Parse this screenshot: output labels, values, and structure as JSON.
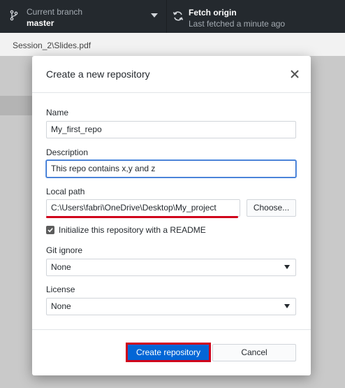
{
  "toolbar": {
    "branch": {
      "title": "Current branch",
      "value": "master",
      "icon": "git-branch-icon"
    },
    "fetch": {
      "title": "Fetch origin",
      "subtitle": "Last fetched a minute ago",
      "icon": "sync-icon"
    }
  },
  "path_bar": {
    "text": "Session_2\\Slides.pdf"
  },
  "background": {
    "hint_char": "."
  },
  "dialog": {
    "title": "Create a new repository",
    "close_icon": "close-icon",
    "fields": {
      "name": {
        "label": "Name",
        "value": "My_first_repo"
      },
      "description": {
        "label": "Description",
        "value": "This repo contains x,y and z"
      },
      "local_path": {
        "label": "Local path",
        "value": "C:\\Users\\fabri\\OneDrive\\Desktop\\My_project",
        "choose_label": "Choose..."
      },
      "readme": {
        "label": "Initialize this repository with a README",
        "checked": true
      },
      "git_ignore": {
        "label": "Git ignore",
        "value": "None"
      },
      "license": {
        "label": "License",
        "value": "None"
      }
    },
    "buttons": {
      "create": "Create repository",
      "cancel": "Cancel"
    }
  },
  "colors": {
    "accent": "#0366d6",
    "annotation_red": "#d0021b",
    "toolbar_bg": "#24292e"
  }
}
